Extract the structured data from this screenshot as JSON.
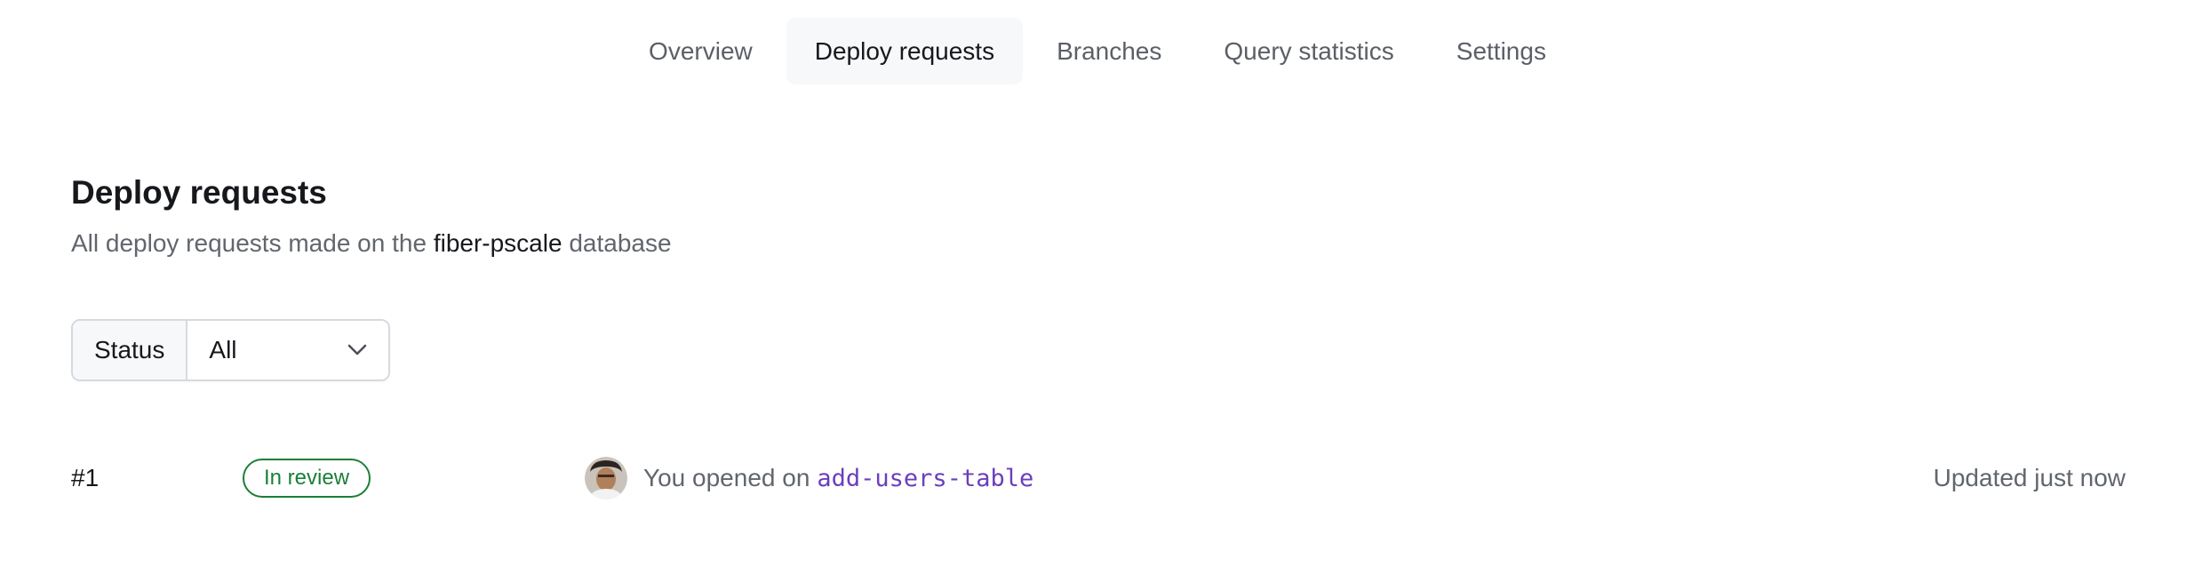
{
  "tabs": [
    {
      "label": "Overview",
      "active": false
    },
    {
      "label": "Deploy requests",
      "active": true
    },
    {
      "label": "Branches",
      "active": false
    },
    {
      "label": "Query statistics",
      "active": false
    },
    {
      "label": "Settings",
      "active": false
    }
  ],
  "header": {
    "title": "Deploy requests",
    "subtitle_prefix": "All deploy requests made on the",
    "database_name": "fiber-pscale",
    "subtitle_suffix": "database"
  },
  "filter": {
    "label": "Status",
    "selected": "All",
    "icon": "chevron-down-icon"
  },
  "requests": [
    {
      "number": "#1",
      "status": "In review",
      "status_color": "#1a7f37",
      "action": "You opened on",
      "branch": "add-users-table",
      "updated": "Updated just now"
    }
  ],
  "colors": {
    "branch": "#6a3fbd",
    "active_tab_bg": "#f6f8fa"
  }
}
